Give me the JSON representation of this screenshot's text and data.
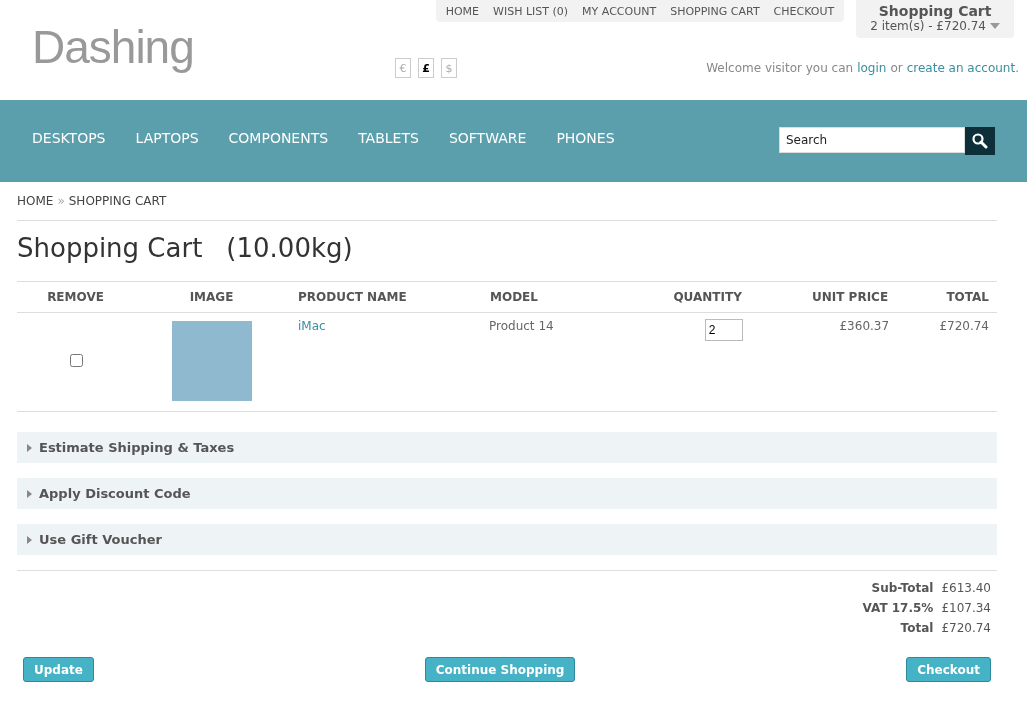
{
  "logo": "Dashing",
  "top_links": [
    "HOME",
    "WISH LIST (0)",
    "MY ACCOUNT",
    "SHOPPING CART",
    "CHECKOUT"
  ],
  "cart_summary": {
    "title": "Shopping Cart",
    "text": "2 item(s) - £720.74"
  },
  "currencies": [
    {
      "symbol": "€",
      "selected": false
    },
    {
      "symbol": "£",
      "selected": true
    },
    {
      "symbol": "$",
      "selected": false
    }
  ],
  "welcome": {
    "text": "Welcome visitor you can",
    "login": "login",
    "or": "or",
    "create": "create an account",
    "end": "."
  },
  "nav": [
    "DESKTOPS",
    "LAPTOPS",
    "COMPONENTS",
    "TABLETS",
    "SOFTWARE",
    "PHONES"
  ],
  "search": {
    "placeholder": "Search"
  },
  "breadcrumb": [
    "HOME",
    "SHOPPING CART"
  ],
  "breadcrumb_separator": "»",
  "heading": "Shopping Cart",
  "weight": "(10.00kg)",
  "table": {
    "columns": [
      "REMOVE",
      "IMAGE",
      "PRODUCT NAME",
      "MODEL",
      "QUANTITY",
      "UNIT PRICE",
      "TOTAL"
    ],
    "rows": [
      {
        "checked": false,
        "name": "iMac",
        "model": "Product 14",
        "quantity": "2",
        "unit_price": "£360.37",
        "total": "£720.74"
      }
    ]
  },
  "sections": [
    {
      "title": "Estimate Shipping & Taxes",
      "expanded": false
    },
    {
      "title": "Apply Discount Code",
      "expanded": false
    },
    {
      "title": "Use Gift Voucher",
      "expanded": false
    }
  ],
  "totals": [
    {
      "label": "Sub-Total",
      "value": "£613.40"
    },
    {
      "label": "VAT 17.5%",
      "value": "£107.34"
    },
    {
      "label": "Total",
      "value": "£720.74"
    }
  ],
  "buttons": [
    "Update",
    "Continue Shopping",
    "Checkout"
  ]
}
